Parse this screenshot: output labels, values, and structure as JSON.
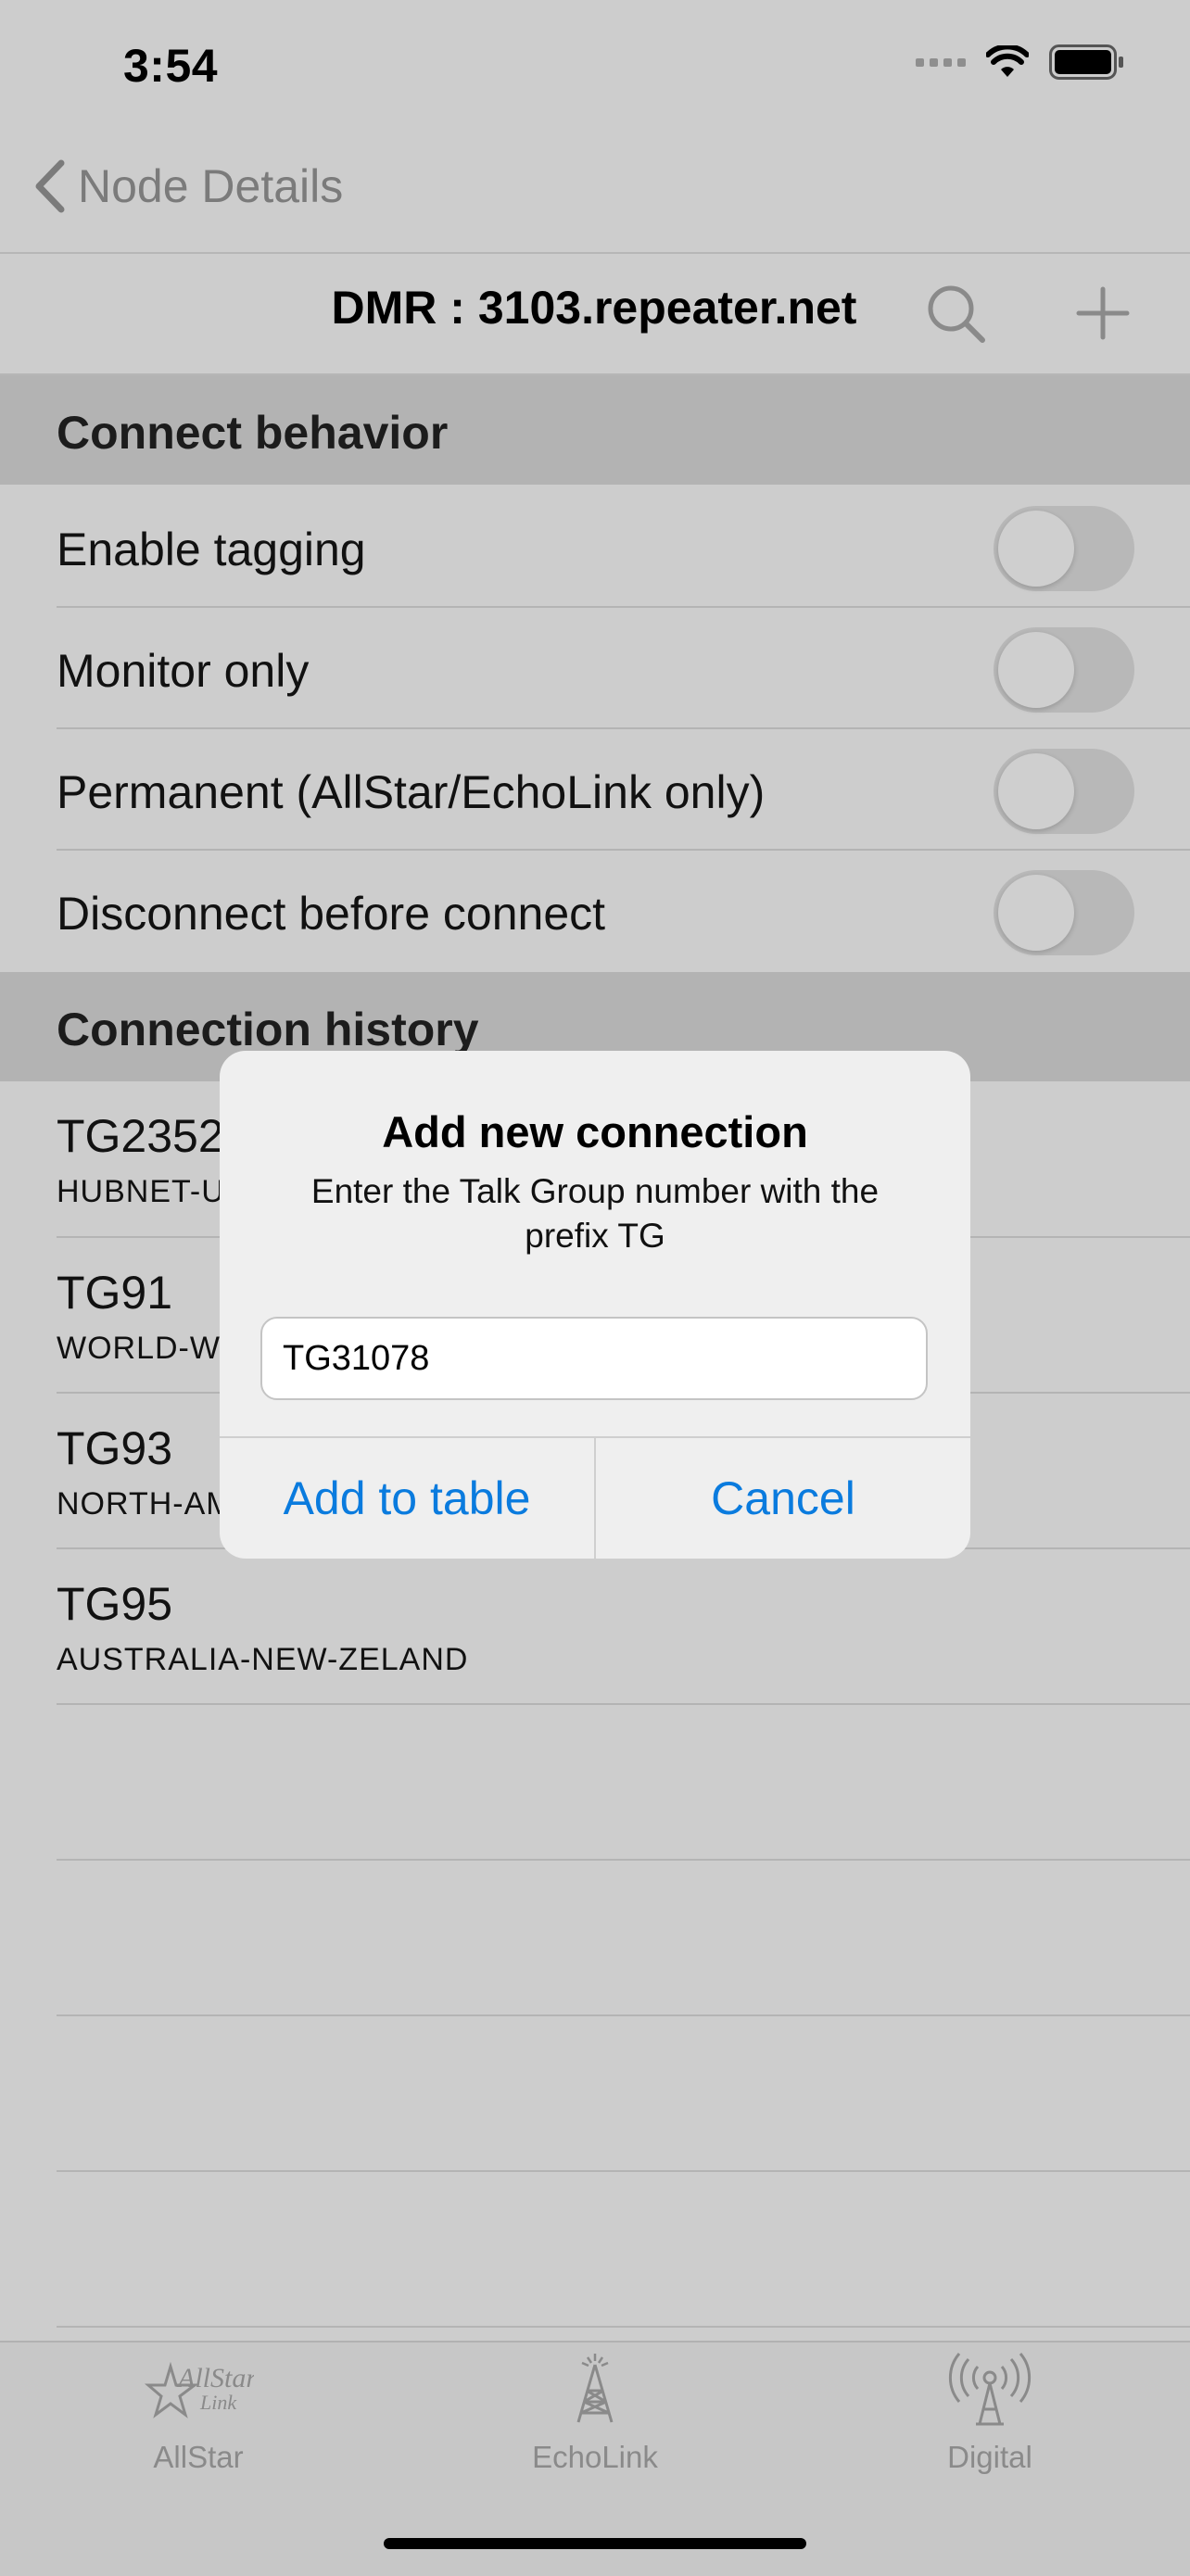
{
  "status_bar": {
    "time": "3:54"
  },
  "nav": {
    "back_label": "Node Details"
  },
  "toolbar": {
    "title": "DMR : 3103.repeater.net"
  },
  "connect_behavior": {
    "header": "Connect behavior",
    "rows": [
      {
        "label": "Enable tagging",
        "on": false
      },
      {
        "label": "Monitor only",
        "on": false
      },
      {
        "label": "Permanent (AllStar/EchoLink only)",
        "on": false
      },
      {
        "label": "Disconnect before connect",
        "on": false
      }
    ]
  },
  "history": {
    "header": "Connection history",
    "items": [
      {
        "title": "TG2352",
        "subtitle": "HUBNET-U"
      },
      {
        "title": "TG91",
        "subtitle": "WORLD-W"
      },
      {
        "title": "TG93",
        "subtitle": "NORTH-AM"
      },
      {
        "title": "TG95",
        "subtitle": "AUSTRALIA-NEW-ZELAND"
      }
    ]
  },
  "dialog": {
    "title": "Add new connection",
    "message": "Enter the Talk Group number with the prefix TG",
    "input_value": "TG31078",
    "confirm_label": "Add to table",
    "cancel_label": "Cancel"
  },
  "tabbar": {
    "tabs": [
      {
        "label": "AllStar",
        "logo_line1": "AllStar",
        "logo_line2": "Link"
      },
      {
        "label": "EchoLink"
      },
      {
        "label": "Digital"
      }
    ]
  },
  "colors": {
    "accent": "#0a7bde",
    "background": "#cdcdcd",
    "section_header": "#b3b3b3"
  }
}
